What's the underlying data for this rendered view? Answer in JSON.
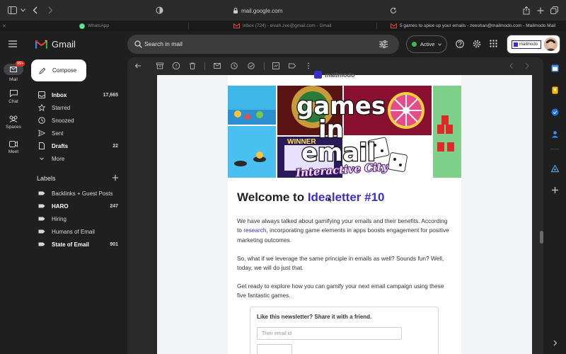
{
  "browser": {
    "url": "mail.google.com",
    "tabs": [
      {
        "label": "WhatsApp"
      },
      {
        "label": "Inbox (724) - eivah.zee@gmail.com - Gmail"
      },
      {
        "label": "5 games to spice up your emails - zeeshan@mailmodo.com - Mailmodo Mail"
      }
    ]
  },
  "gmail": {
    "logo_text": "Gmail",
    "search": {
      "placeholder": "Search in mail"
    },
    "status": {
      "label": "Active"
    },
    "account_brand": "mailmodo",
    "compose_label": "Compose",
    "rail": [
      {
        "label": "Mail",
        "badge": "99+"
      },
      {
        "label": "Chat"
      },
      {
        "label": "Spaces"
      },
      {
        "label": "Meet"
      }
    ],
    "nav": [
      {
        "label": "Inbox",
        "count": "17,665"
      },
      {
        "label": "Starred",
        "count": ""
      },
      {
        "label": "Snoozed",
        "count": ""
      },
      {
        "label": "Sent",
        "count": ""
      },
      {
        "label": "Drafts",
        "count": "22"
      },
      {
        "label": "More",
        "count": ""
      }
    ],
    "labels_title": "Labels",
    "labels": [
      {
        "label": "Backlinks + Guest Posts",
        "count": ""
      },
      {
        "label": "HARO",
        "count": "247"
      },
      {
        "label": "Hiring",
        "count": ""
      },
      {
        "label": "Humans of Email",
        "count": ""
      },
      {
        "label": "State of Email",
        "count": "901"
      }
    ]
  },
  "email": {
    "brand_partial": "mailmodo",
    "hero": {
      "line1": "games",
      "line2": "in",
      "line3": "email",
      "script": "Interactive City",
      "winner": "WINNER"
    },
    "heading_prefix": "Welcome to ",
    "heading_link": "Idealetter #10",
    "p1_before": "We have always talked about gamifying your emails and their benefits. According to ",
    "p1_link": "research",
    "p1_after": ", incorporating game elements in apps boosts engagement for positive marketing outcomes.",
    "p2": "So, what if we leverage the same principle in emails as well? Sounds fun? Well, today, we will do just that.",
    "p3": "Get ready to explore how you can gamify your next email campaign using these five fantastic games.",
    "share": {
      "title": "Like this newsletter? Share it with a friend.",
      "placeholder": "Their email id"
    }
  },
  "colors": {
    "link": "#3b2fc9",
    "active_green": "#3cba54",
    "compose_bg": "#ffffff"
  }
}
